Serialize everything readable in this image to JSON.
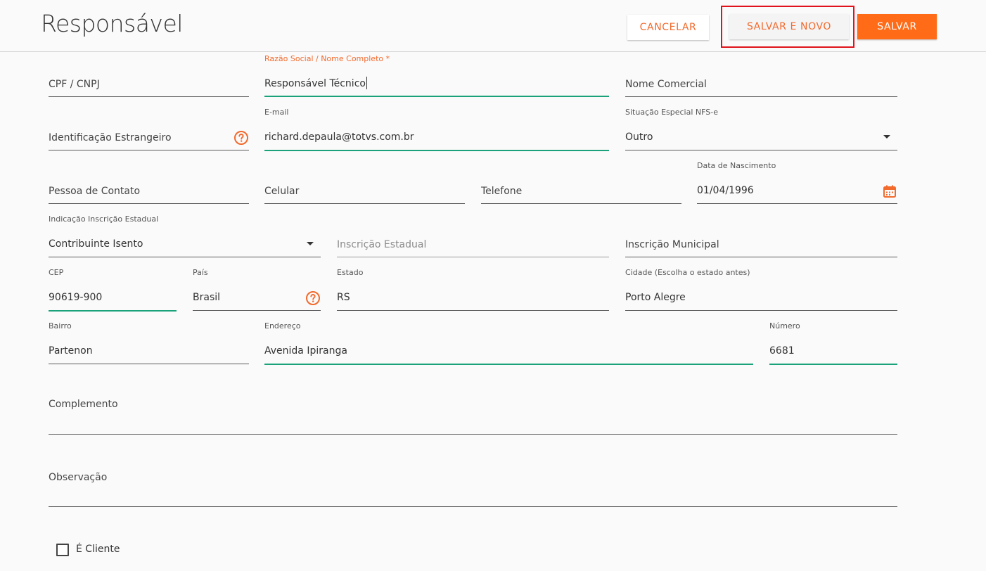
{
  "header": {
    "title": "Responsável",
    "cancel_label": "CANCELAR",
    "save_new_label": "SALVAR E NOVO",
    "save_label": "SALVAR"
  },
  "form": {
    "cpf_cnpj": {
      "placeholder": "CPF / CNPJ"
    },
    "razao_social": {
      "label": "Razão Social / Nome Completo *",
      "value": "Responsável Técnico"
    },
    "nome_comercial": {
      "placeholder": "Nome Comercial"
    },
    "identificacao_estrangeiro": {
      "placeholder": "Identificação Estrangeiro",
      "icon": "help-circle-icon"
    },
    "email": {
      "label": "E-mail",
      "value": "richard.depaula@totvs.com.br"
    },
    "situacao_especial": {
      "label": "Situação Especial NFS-e",
      "value": "Outro"
    },
    "pessoa_contato": {
      "placeholder": "Pessoa de Contato"
    },
    "celular": {
      "placeholder": "Celular"
    },
    "telefone": {
      "placeholder": "Telefone"
    },
    "data_nascimento": {
      "label": "Data de Nascimento",
      "value": "01/04/1996",
      "icon": "calendar-icon"
    },
    "indicacao_ie": {
      "label": "Indicação Inscrição Estadual",
      "value": "Contribuinte Isento"
    },
    "inscricao_estadual": {
      "placeholder": "Inscrição Estadual"
    },
    "inscricao_municipal": {
      "placeholder": "Inscrição Municipal"
    },
    "cep": {
      "label": "CEP",
      "value": "90619-900"
    },
    "pais": {
      "label": "País",
      "value": "Brasil",
      "icon": "help-circle-icon"
    },
    "estado": {
      "label": "Estado",
      "value": "RS"
    },
    "cidade": {
      "label": "Cidade (Escolha o estado antes)",
      "value": "Porto Alegre"
    },
    "bairro": {
      "label": "Bairro",
      "value": "Partenon"
    },
    "endereco": {
      "label": "Endereço",
      "value": "Avenida Ipiranga"
    },
    "numero": {
      "label": "Número",
      "value": "6681"
    },
    "complemento": {
      "placeholder": "Complemento"
    },
    "observacao": {
      "placeholder": "Observação"
    },
    "e_cliente": {
      "label": "É Cliente",
      "checked": false
    }
  },
  "colors": {
    "accent": "#ff6b16",
    "focus": "#1aa37a",
    "highlight": "#e0121b"
  }
}
